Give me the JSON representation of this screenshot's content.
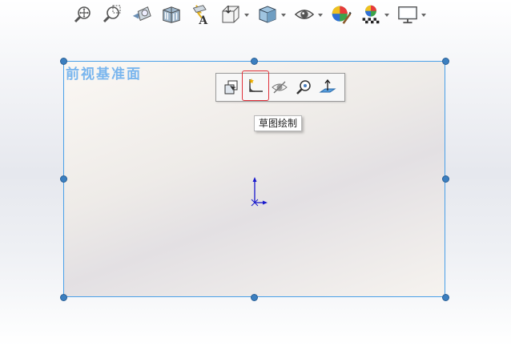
{
  "plane": {
    "label": "前视基准面"
  },
  "context_toolbar": {
    "tooltip": "草图绘制"
  },
  "colors": {
    "plane_border": "#4aa0e8",
    "handle": "#3b7fc0",
    "highlight": "#e0303a",
    "origin": "#1a1acc"
  },
  "hud_icons": [
    "zoom-to-fit-icon",
    "zoom-to-area-icon",
    "previous-view-icon",
    "section-view-icon",
    "dynamic-annotation-icon",
    "view-orientation-icon",
    "display-style-icon",
    "hide-show-items-icon",
    "edit-appearance-icon",
    "apply-scene-icon",
    "view-settings-icon"
  ],
  "context_icons": [
    "normal-to-icon",
    "sketch-icon",
    "hide-icon",
    "zoom-to-selection-icon",
    "plane-normal-icon"
  ]
}
